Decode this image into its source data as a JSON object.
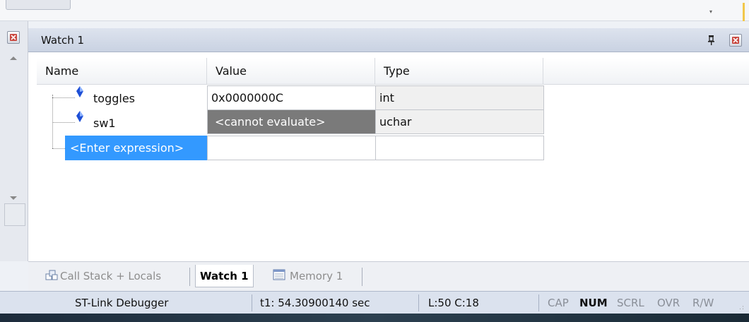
{
  "window": {
    "title": "Watch 1"
  },
  "watch": {
    "columns": {
      "name": "Name",
      "value": "Value",
      "type": "Type"
    },
    "rows": [
      {
        "name": "toggles",
        "value": "0x0000000C",
        "type": "int"
      },
      {
        "name": "sw1",
        "value": "<cannot evaluate>",
        "type": "uchar"
      }
    ],
    "enter_expression": "<Enter expression>"
  },
  "tabs": [
    {
      "label": "Call Stack + Locals",
      "icon": "call-stack-icon",
      "active": false
    },
    {
      "label": "Watch 1",
      "active": true
    },
    {
      "label": "Memory 1",
      "icon": "memory-icon",
      "active": false
    }
  ],
  "status": {
    "debugger": "ST-Link Debugger",
    "time": "t1: 54.30900140 sec",
    "position": "L:50 C:18",
    "indicators": [
      {
        "label": "CAP",
        "active": false
      },
      {
        "label": "NUM",
        "active": true
      },
      {
        "label": "SCRL",
        "active": false
      },
      {
        "label": "OVR",
        "active": false
      },
      {
        "label": "R/W",
        "active": false
      }
    ]
  },
  "colors": {
    "selection": "#3399ff",
    "cannot_evaluate_bg": "#7a7a7a",
    "header_gradient": "#c9d2e2",
    "gem": "#1e4fd6"
  }
}
